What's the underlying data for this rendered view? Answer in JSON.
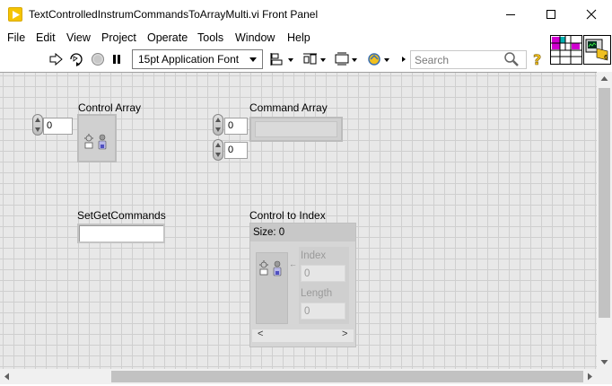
{
  "window": {
    "title": "TextControlledInstrumCommandsToArrayMulti.vi Front Panel",
    "minimize_label": "—",
    "maximize_label": "☐",
    "close_label": "✕"
  },
  "menu": {
    "items": [
      "File",
      "Edit",
      "View",
      "Project",
      "Operate",
      "Tools",
      "Window",
      "Help"
    ]
  },
  "toolbar": {
    "font": "15pt Application Font",
    "search_placeholder": "Search",
    "icons": [
      "run-arrow-icon",
      "run-continuously-icon",
      "abort-icon",
      "pause-icon",
      "align-objects-icon",
      "distribute-objects-icon",
      "resize-objects-icon",
      "reorder-icon",
      "search-icon",
      "help-icon"
    ]
  },
  "panel": {
    "control_array": {
      "label": "Control Array",
      "index": "0"
    },
    "command_array": {
      "label": "Command Array",
      "index_0": "0",
      "index_1": "0"
    },
    "setget": {
      "label": "SetGetCommands"
    },
    "control_to_index": {
      "label": "Control to Index",
      "size_text": "Size: 0",
      "index_label": "Index",
      "index_value": "0",
      "length_label": "Length",
      "length_value": "0",
      "scroll_left": "<",
      "scroll_right": ">"
    }
  },
  "colors": {
    "panel_bg": "#e8e8e8",
    "grid": "#cfcfcf",
    "vi_icon_yellow": "#f5c400"
  }
}
